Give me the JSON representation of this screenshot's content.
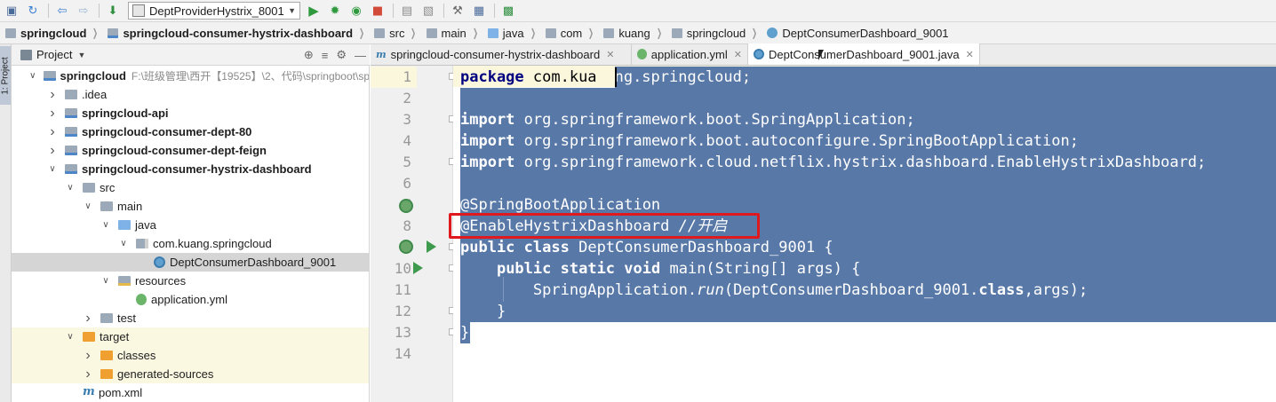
{
  "toolbar": {
    "buttons": [
      "save-icon",
      "sync-icon",
      "back-icon",
      "forward-icon",
      "build-icon"
    ],
    "run_config": "DeptProviderHystrix_8001",
    "right_buttons": [
      "run-icon",
      "debug-icon",
      "coverage-icon",
      "stop-icon",
      "structure-icon",
      "sdk-icon",
      "settings-icon",
      "layout-icon",
      "vcs-icon"
    ]
  },
  "breadcrumb": {
    "items": [
      "springcloud",
      "springcloud-consumer-hystrix-dashboard",
      "src",
      "main",
      "java",
      "com",
      "kuang",
      "springcloud",
      "DeptConsumerDashboard_9001"
    ]
  },
  "side_stripe": {
    "label": "1: Project"
  },
  "project_panel": {
    "title": "Project",
    "tree": [
      {
        "label": "springcloud",
        "path": "F:\\班级管理\\西开【19525】\\2、代码\\springboot\\sp",
        "indent": 0,
        "twisty": "open",
        "icon": "module",
        "bold": true
      },
      {
        "label": ".idea",
        "indent": 1,
        "twisty": "closed",
        "icon": "folder"
      },
      {
        "label": "springcloud-api",
        "indent": 1,
        "twisty": "closed",
        "icon": "module",
        "bold": true
      },
      {
        "label": "springcloud-consumer-dept-80",
        "indent": 1,
        "twisty": "closed",
        "icon": "module",
        "bold": true
      },
      {
        "label": "springcloud-consumer-dept-feign",
        "indent": 1,
        "twisty": "closed",
        "icon": "module",
        "bold": true
      },
      {
        "label": "springcloud-consumer-hystrix-dashboard",
        "indent": 1,
        "twisty": "open",
        "icon": "module",
        "bold": true
      },
      {
        "label": "src",
        "indent": 2,
        "twisty": "open",
        "icon": "folder"
      },
      {
        "label": "main",
        "indent": 3,
        "twisty": "open",
        "icon": "folder"
      },
      {
        "label": "java",
        "indent": 4,
        "twisty": "open",
        "icon": "srcfolder"
      },
      {
        "label": "com.kuang.springcloud",
        "indent": 5,
        "twisty": "open",
        "icon": "package"
      },
      {
        "label": "DeptConsumerDashboard_9001",
        "indent": 6,
        "twisty": "none",
        "icon": "class",
        "selected": true
      },
      {
        "label": "resources",
        "indent": 4,
        "twisty": "open",
        "icon": "resfolder"
      },
      {
        "label": "application.yml",
        "indent": 5,
        "twisty": "none",
        "icon": "yml"
      },
      {
        "label": "test",
        "indent": 3,
        "twisty": "closed",
        "icon": "folder"
      },
      {
        "label": "target",
        "indent": 2,
        "twisty": "open",
        "icon": "target",
        "target_bg": true
      },
      {
        "label": "classes",
        "indent": 3,
        "twisty": "closed",
        "icon": "orange",
        "target_bg": true
      },
      {
        "label": "generated-sources",
        "indent": 3,
        "twisty": "closed",
        "icon": "orange",
        "target_bg": true
      },
      {
        "label": "pom.xml",
        "indent": 2,
        "twisty": "none",
        "icon": "pom"
      }
    ]
  },
  "editor": {
    "tabs": [
      {
        "label": "springcloud-consumer-hystrix-dashboard",
        "icon": "m",
        "active": false
      },
      {
        "label": "application.yml",
        "icon": "y",
        "active": false
      },
      {
        "label": "DeptConsumerDashboard_9001.java",
        "icon": "c",
        "active": true
      }
    ],
    "line_numbers": [
      "1",
      "2",
      "3",
      "4",
      "5",
      "6",
      "7",
      "8",
      "9",
      "10",
      "11",
      "12",
      "13",
      "14"
    ],
    "code": [
      [
        {
          "t": "package",
          "k": "kw"
        },
        {
          "t": " com.kuang.springcloud;"
        }
      ],
      [],
      [
        {
          "t": "import",
          "k": "kw"
        },
        {
          "t": " org.springframework.boot.SpringApplication;"
        }
      ],
      [
        {
          "t": "import",
          "k": "kw"
        },
        {
          "t": " org.springframework.boot.autoconfigure.SpringBootApplication;"
        }
      ],
      [
        {
          "t": "import",
          "k": "kw"
        },
        {
          "t": " org.springframework.cloud.netflix.hystrix.dashboard.EnableHystrixDashboard;"
        }
      ],
      [],
      [
        {
          "t": "@SpringBootApplication"
        }
      ],
      [
        {
          "t": "@EnableHystrixDashboard "
        },
        {
          "t": "//开启",
          "k": "it"
        }
      ],
      [
        {
          "t": "public",
          "k": "kw"
        },
        {
          "t": " "
        },
        {
          "t": "class",
          "k": "kw"
        },
        {
          "t": " DeptConsumerDashboard_9001 {"
        }
      ],
      [
        {
          "t": "    "
        },
        {
          "t": "public",
          "k": "kw"
        },
        {
          "t": " "
        },
        {
          "t": "static",
          "k": "kw"
        },
        {
          "t": " "
        },
        {
          "t": "void",
          "k": "kw"
        },
        {
          "t": " main(String[] args) {"
        }
      ],
      [
        {
          "t": "        SpringApplication."
        },
        {
          "t": "run",
          "k": "it"
        },
        {
          "t": "(DeptConsumerDashboard_9001."
        },
        {
          "t": "class",
          "k": "kw"
        },
        {
          "t": ",args);"
        }
      ],
      [
        {
          "t": "    }"
        }
      ],
      [
        {
          "t": "}"
        }
      ],
      []
    ]
  },
  "colors": {
    "selection": "#5878a8",
    "highlight_box": "#e0191e",
    "current_line": "#fbf7dd"
  }
}
